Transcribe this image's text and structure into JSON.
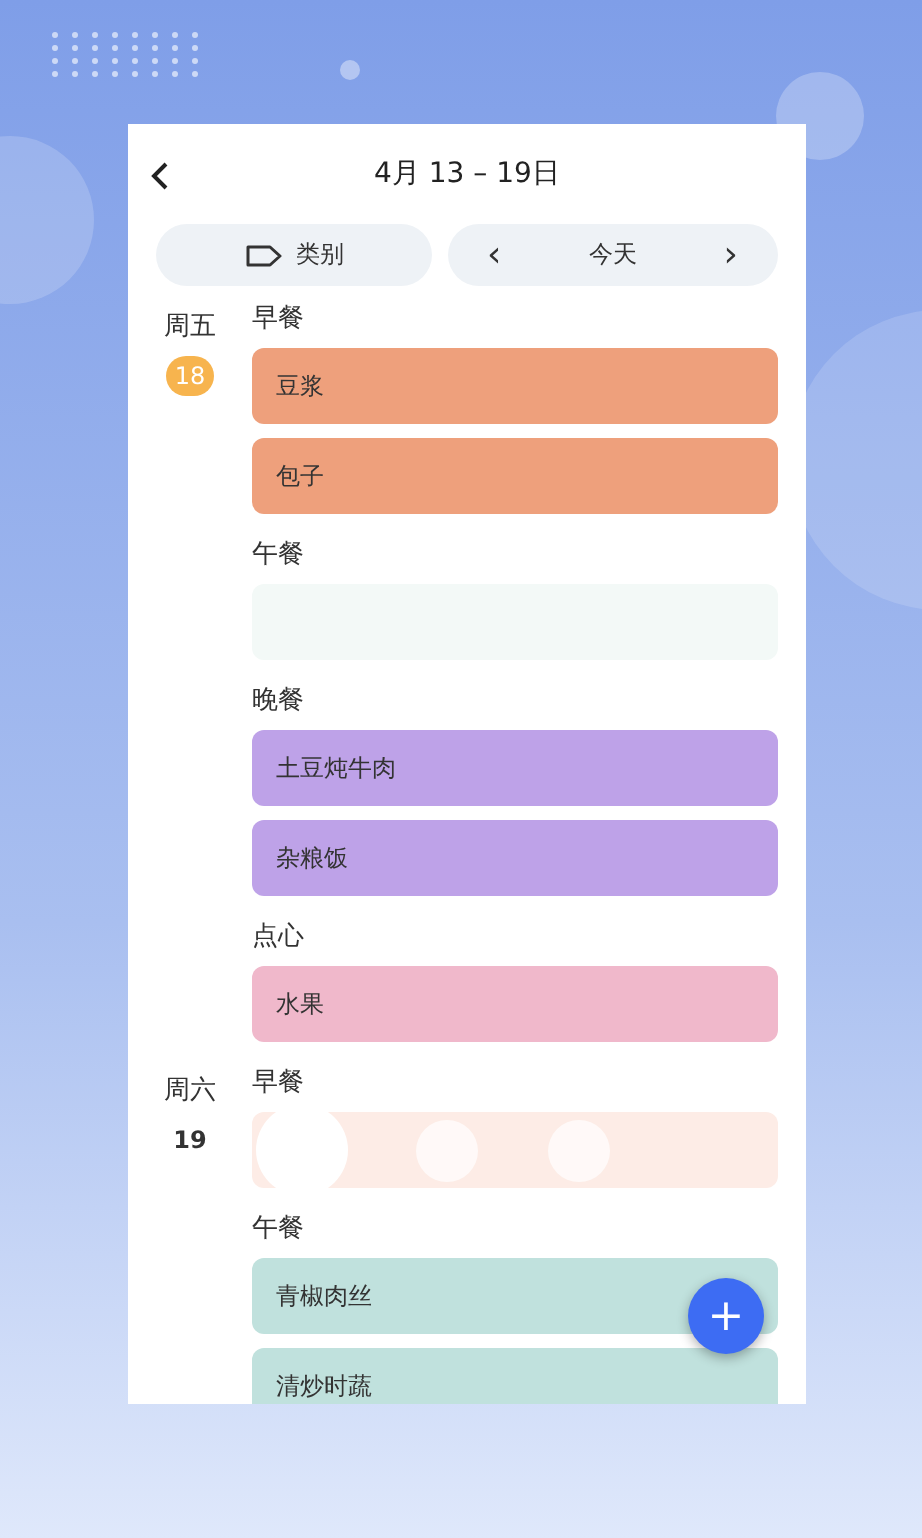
{
  "header": {
    "title": "4月 13 – 19日"
  },
  "toolbar": {
    "category": "类别",
    "prev": "‹",
    "today": "今天",
    "next": "›"
  },
  "days": [
    {
      "weekday": "周五",
      "date": "18",
      "today": true,
      "meals": [
        {
          "name": "早餐",
          "kind": "items",
          "items": [
            {
              "label": "豆浆",
              "color": "#eea07c"
            },
            {
              "label": "包子",
              "color": "#eea07c"
            }
          ]
        },
        {
          "name": "午餐",
          "kind": "empty",
          "color": "#f3f9f7"
        },
        {
          "name": "晚餐",
          "kind": "items",
          "items": [
            {
              "label": "土豆炖牛肉",
              "color": "#bea2e8"
            },
            {
              "label": "杂粮饭",
              "color": "#bea2e8"
            }
          ]
        },
        {
          "name": "点心",
          "kind": "items",
          "items": [
            {
              "label": "水果",
              "color": "#f0b8cb"
            }
          ]
        }
      ]
    },
    {
      "weekday": "周六",
      "date": "19",
      "today": false,
      "meals": [
        {
          "name": "早餐",
          "kind": "loading",
          "color": "#fdece6"
        },
        {
          "name": "午餐",
          "kind": "items",
          "items": [
            {
              "label": "青椒肉丝",
              "color": "#c0e1dd"
            },
            {
              "label": "清炒时蔬",
              "color": "#c0e1dd"
            }
          ]
        }
      ]
    }
  ],
  "fab": "+"
}
